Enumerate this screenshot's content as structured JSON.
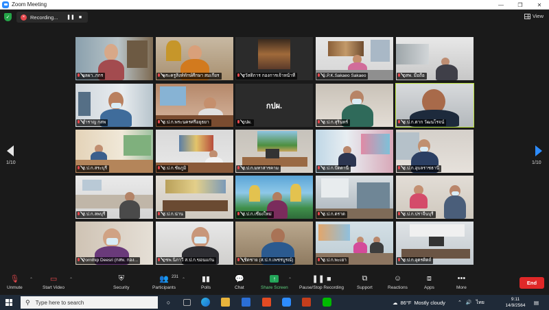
{
  "window": {
    "title": "Zoom Meeting",
    "controls": [
      "—",
      "❐",
      "✕"
    ]
  },
  "recording": {
    "label": "Recording...",
    "pause": "❚❚",
    "stop": "■"
  },
  "view_button": {
    "label": "View"
  },
  "pagination": {
    "left": "1/10",
    "right": "1/10"
  },
  "tiles": [
    {
      "label": "ผลผา..กกร",
      "muted": false
    },
    {
      "label": "พระครูสิงห์ทักษ์ศึกษา สมเกียร",
      "muted": true
    },
    {
      "label": "สวัสดิการ กองการเจ้าหน้าที่",
      "muted": true
    },
    {
      "label": "S.P.K.Sakaeo Sakaeo",
      "muted": false
    },
    {
      "label": "กสพ. มือถือ",
      "muted": true
    },
    {
      "label": "สำราญ กสพ",
      "muted": true
    },
    {
      "label": "ส.ป.ก.พระนครศรีอยุธยา",
      "muted": true
    },
    {
      "label": "กปผ.",
      "muted": true,
      "center": "กปผ."
    },
    {
      "label": "ส.ป.ก.สุรินทร์",
      "muted": true
    },
    {
      "label": "ส.ป.ก.ตาก วัฒนโรจน์",
      "muted": true
    },
    {
      "label": "ส.ป.ก.สระบุรี",
      "muted": true
    },
    {
      "label": "ส.ป.ก.ชัยภูมิ",
      "muted": true
    },
    {
      "label": "ส.ป.ก.มหาสารคาม",
      "muted": true
    },
    {
      "label": "ส.ป.ก.ปัตตานี",
      "muted": true
    },
    {
      "label": "ส.ป.ก.อุบลราชธานี",
      "muted": true
    },
    {
      "label": "ส.ป.ก.ลพบุรี",
      "muted": true
    },
    {
      "label": "ส.ป.ก.น่าน",
      "muted": true
    },
    {
      "label": "ส.ป.ก.เชียงใหม่",
      "muted": true
    },
    {
      "label": "ส.ป.ก.ตราด",
      "muted": true
    },
    {
      "label": "ส.ป.ก.ปราจีนบุรี",
      "muted": true
    },
    {
      "label": "Pornthip Deesri (กสพ. กอง...",
      "muted": false
    },
    {
      "label": "กชพ.นิภาวี ส.ป.ก.ขอนแก่น",
      "muted": true
    },
    {
      "label": "เชิดชาย (ส.ป.ก.เพชรบูรณ์)",
      "muted": false
    },
    {
      "label": "ส.ป.ก.พะเยา",
      "muted": true
    },
    {
      "label": "ส.ป.ก.อุตรดิตถ์",
      "muted": true
    }
  ],
  "toolbar": {
    "unmute": "Unmute",
    "start_video": "Start Video",
    "security": "Security",
    "participants": "Participants",
    "participants_count": "231",
    "polls": "Polls",
    "chat": "Chat",
    "share_screen": "Share Screen",
    "pause_stop_recording": "Pause/Stop Recording",
    "support": "Support",
    "reactions": "Reactions",
    "apps": "Apps",
    "more": "More",
    "end": "End"
  },
  "taskbar": {
    "search_placeholder": "Type here to search",
    "weather_temp": "86°F",
    "weather_text": "Mostly cloudy",
    "language": "ไทย",
    "time": "9:11",
    "date": "14/9/2564"
  },
  "colors": {
    "accent_green": "#23a559",
    "end_red": "#e02828",
    "active_outline": "#b8e03a",
    "muted_red": "#e5484d"
  }
}
